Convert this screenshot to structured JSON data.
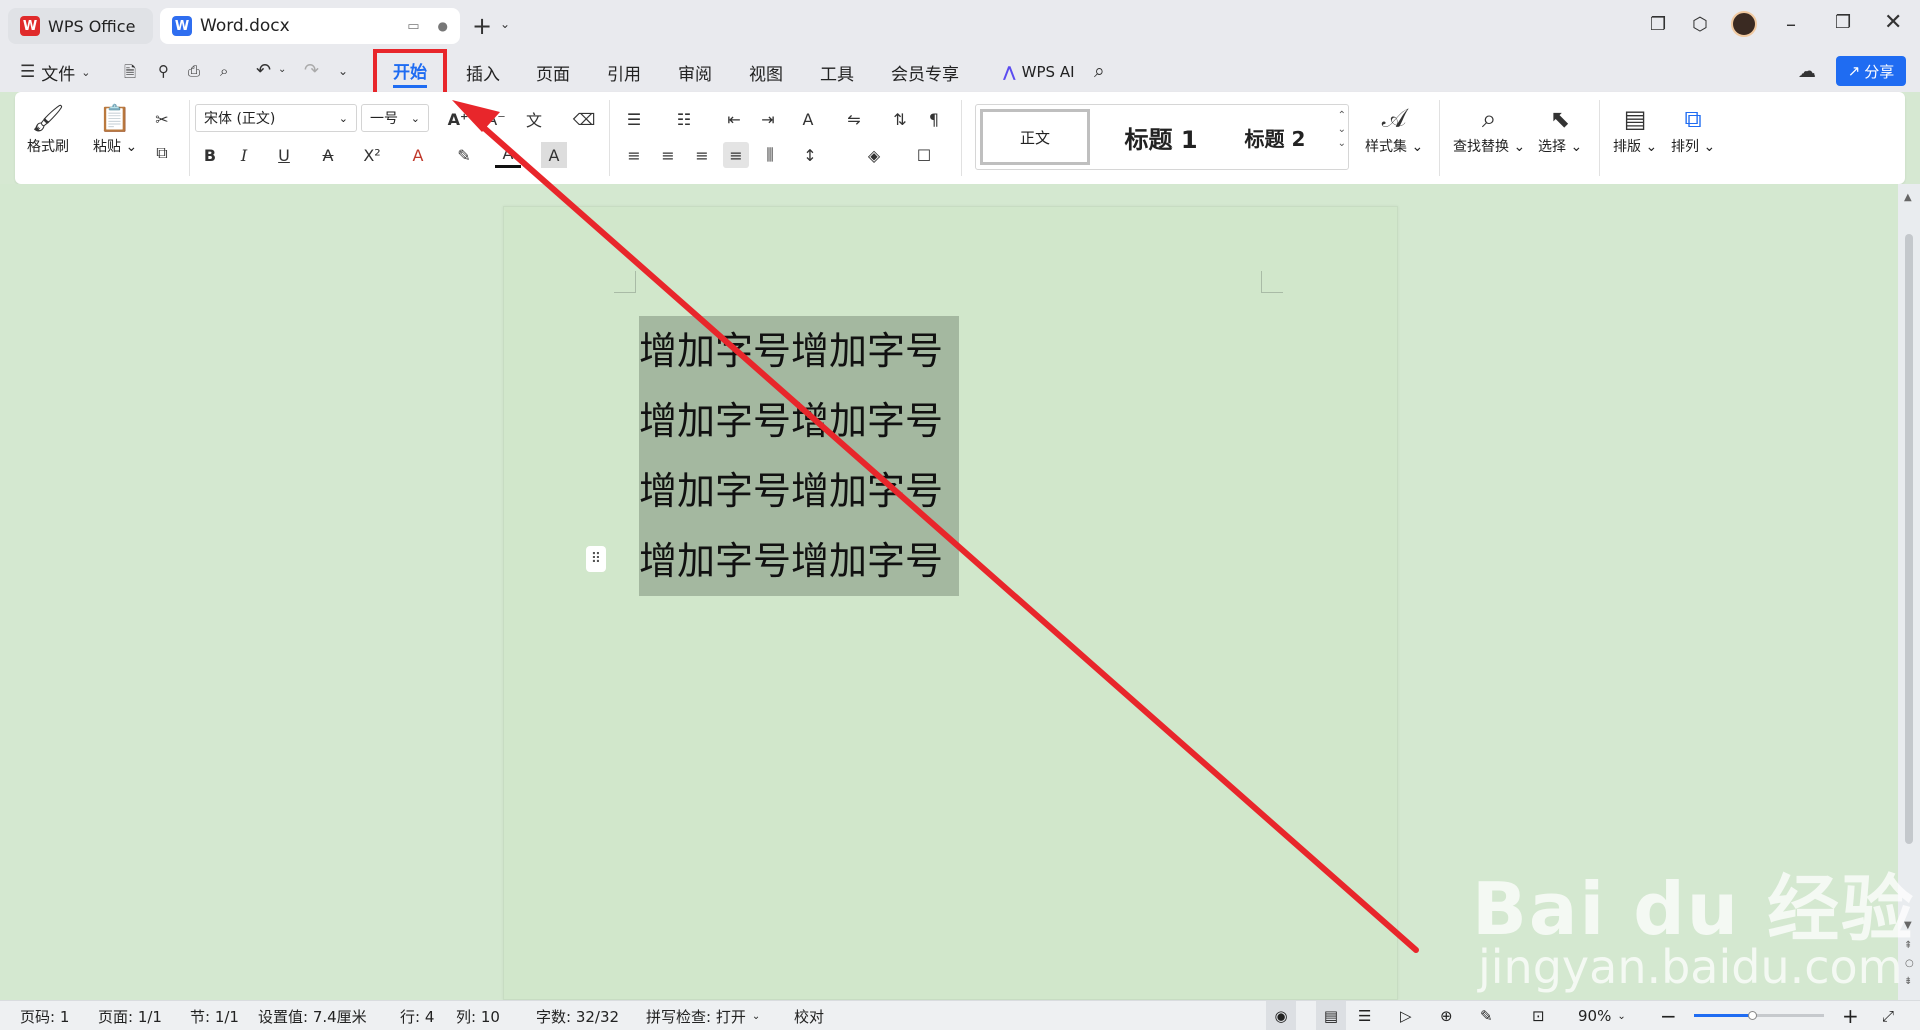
{
  "tabs": {
    "home_tab": "WPS Office",
    "doc_tab": "Word.docx"
  },
  "menu": {
    "file": "文件",
    "items": [
      "开始",
      "插入",
      "页面",
      "引用",
      "审阅",
      "视图",
      "工具",
      "会员专享"
    ],
    "wps_ai": "WPS AI",
    "share": "分享"
  },
  "ribbon": {
    "format_painter": "格式刷",
    "paste": "粘贴",
    "font_name": "宋体 (正文)",
    "font_size": "一号",
    "styles": {
      "normal": "正文",
      "h1": "标题 1",
      "h2": "标题 2"
    },
    "style_set": "样式集",
    "find_replace": "查找替换",
    "select": "选择",
    "layout": "排版",
    "arrange": "排列"
  },
  "document": {
    "lines": [
      "增加字号增加字号",
      "增加字号增加字号",
      "增加字号增加字号",
      "增加字号增加字号"
    ]
  },
  "status": {
    "page_no": "页码: 1",
    "pages": "页面: 1/1",
    "section": "节: 1/1",
    "position": "设置值: 7.4厘米",
    "row": "行: 4",
    "col": "列: 10",
    "words": "字数: 32/32",
    "spell": "拼写检查: 打开",
    "proof": "校对",
    "zoom": "90%"
  },
  "watermark": {
    "brand": "Bai du 经验",
    "url": "jingyan.baidu.com"
  },
  "colors": {
    "accent": "#1f6cf2",
    "highlight_box": "#e8262b",
    "arrow": "#e8262b",
    "selection": "#a4b8a0"
  }
}
